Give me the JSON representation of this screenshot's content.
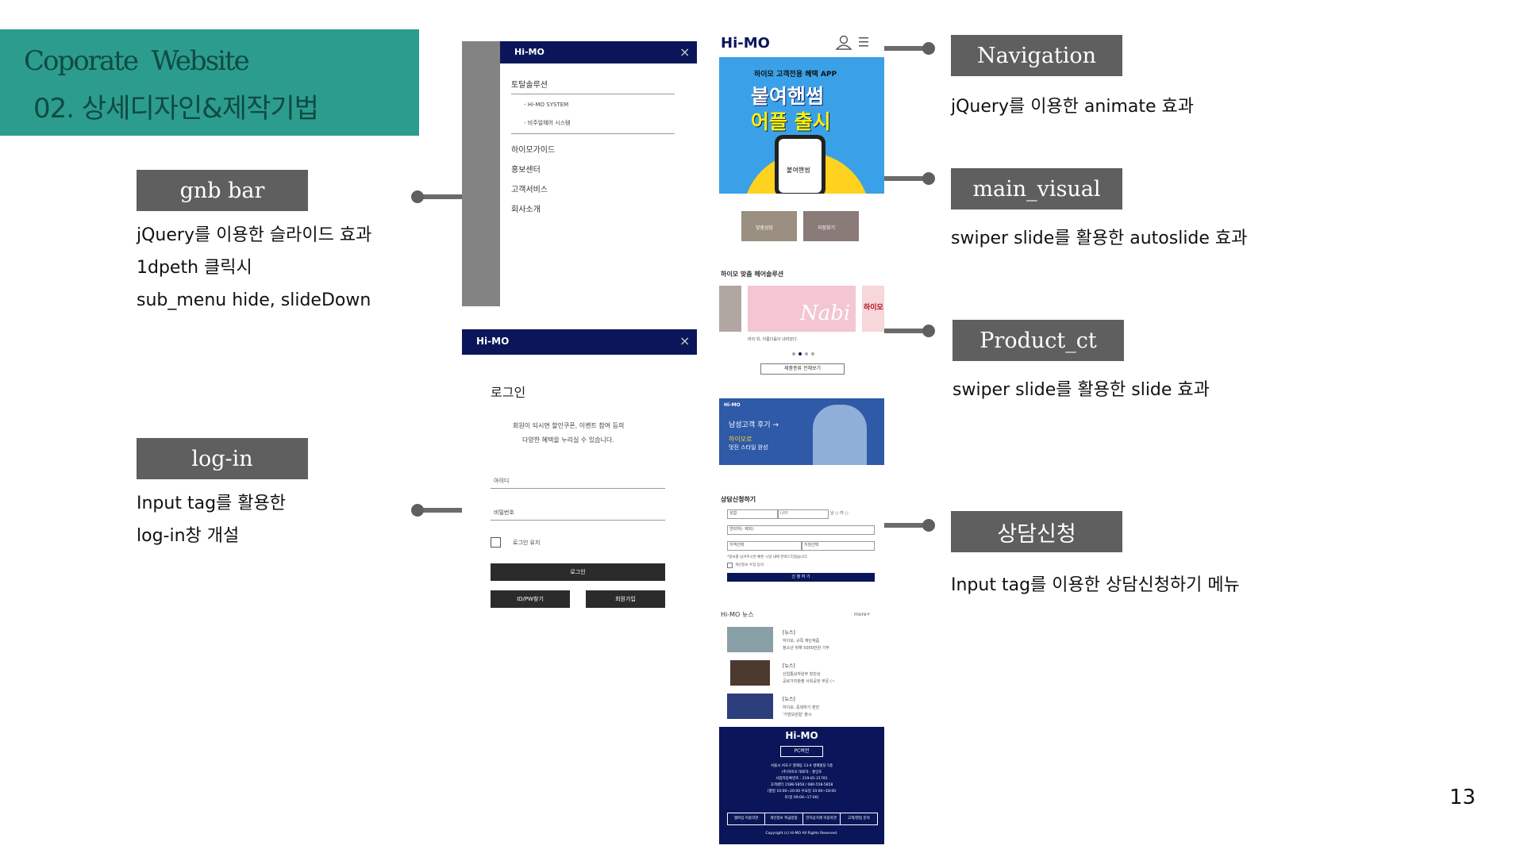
{
  "title": {
    "english": "Coporate  Website",
    "korean": "02. 상세디자인&제작기법"
  },
  "annotations": {
    "gnb": {
      "label": "gnb bar",
      "lines": [
        "jQuery를 이용한 슬라이드 효과",
        "1dpeth 클릭시",
        "sub_menu hide, slideDown"
      ]
    },
    "login": {
      "label": "log-in",
      "lines": [
        "Input tag를 활용한",
        "log-in창 개설"
      ]
    },
    "navigation": {
      "label": "Navigation",
      "lines": [
        "jQuery를 이용한 animate 효과"
      ]
    },
    "main_visual": {
      "label": "main_visual",
      "lines": [
        "swiper slide를 활용한 autoslide 효과"
      ]
    },
    "product": {
      "label": "Product_ct",
      "lines": [
        "swiper slide를 활용한 slide 효과"
      ]
    },
    "consult": {
      "label": "상담신청",
      "lines": [
        "Input tag를 이용한 상담신청하기 메뉴"
      ]
    }
  },
  "gnb_mockup": {
    "logo": "Hi-MO",
    "close": "×",
    "menu": [
      "토탈솔루션",
      "- Hi-MO SYSTEM",
      "- 비주얼헤어 시스템",
      "하이모가이드",
      "홍보센터",
      "고객서비스",
      "회사소개"
    ]
  },
  "login_mockup": {
    "logo": "Hi-MO",
    "close": "×",
    "heading": "로그인",
    "intro_1": "회원이 되시면 할인쿠폰, 이벤트 참여 등의",
    "intro_2": "다양한 혜택을 누리실 수 있습니다.",
    "id_label": "아이디",
    "pw_label": "비밀번호",
    "keep": "로그인 유지",
    "login_btn": "로그인",
    "find_btn": "ID/PW찾기",
    "join_btn": "회원가입"
  },
  "main_mockup": {
    "logo": "Hi-MO",
    "visual_top": "하이모 고객전용 혜택 APP",
    "visual_big_1": "붙여핸썸",
    "visual_big_2": "어플 출시",
    "phone_text": "붙여핸썸",
    "thumb_1": "맞춤상담",
    "thumb_2": "지점찾기",
    "solution_title": "하이모 맞춤 헤어솔루션",
    "nabi": "Nabi",
    "product_caption": "머리 위, 아름다움이 내려앉다.",
    "side_tag": "하이모",
    "view_all": "제품종류 전체보기",
    "banner_logo": "Hi-MO",
    "banner_title": "남성고객 후기 →",
    "banner_sub_1": "하이모로",
    "banner_sub_2": "멋진 스타일 완성",
    "consult_title": "상담신청하기",
    "consult_name": "성함",
    "consult_age": "나이",
    "consult_gender": "남 ○ 여 ○",
    "consult_phone": "연락처(- 제외)",
    "consult_region": "지역선택",
    "consult_branch": "지점선택",
    "consult_note": "*정보를 남겨주시면 빠른 시일 내에 연락드리겠습니다.",
    "consult_agree": "개인정보 수집 동의",
    "consult_btn": "신 청 하 기",
    "news_title": "Hi-MO 뉴스",
    "news_more": "more+",
    "news": [
      {
        "tag": "[뉴스]",
        "line1": "하이모, 규쪽 재단계좀",
        "line2": "청소년 위해 5000만원 기부"
      },
      {
        "tag": "[뉴스]",
        "line1": "산업통상자원부 장관상",
        "line2": "공로가치창출 사회공헌 부문 (~"
      },
      {
        "tag": "[뉴스]",
        "line1": "하이모, 중대하기 편한",
        "line2": "'가발보관함' 출시"
      }
    ],
    "footer_logo": "Hi-MO",
    "footer_pc": "PC버전",
    "footer_lines": [
      "서울시 서초구 명해동 13-4 명해빌딩 5층",
      "(주)하이모 대표자 : 홍민호",
      "사업자등록번호 : 219-81-21781",
      "고객센터 1588-5858 / 080-558-5858",
      "(평일 10:00~20:00 수요일 10:00~18:00",
      "토/일 09:00~17:00)"
    ],
    "footer_links": [
      "멤버십 이용약관",
      "개인정보 취급방침",
      "전자상거래 이용약관",
      "고객/영업 문의"
    ],
    "copyright": "Copyright (c) Hi-MO All Rights Reserved."
  },
  "page_number": "13",
  "colors": {
    "teal": "#2c9c8e",
    "navy": "#0a1659",
    "label_gray": "#5f5f5f"
  }
}
